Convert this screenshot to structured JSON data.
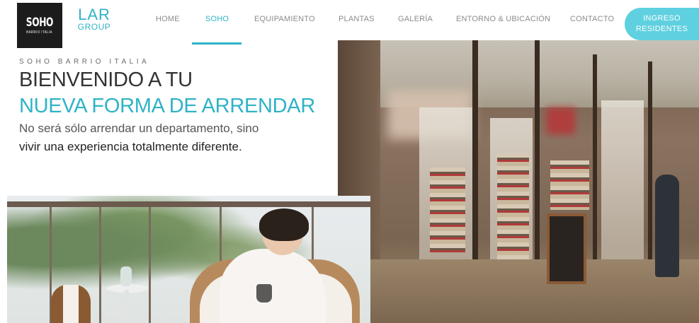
{
  "header": {
    "soho_logo": {
      "big": "SOHO",
      "small": "BARRIO ITALIA"
    },
    "lar_logo": {
      "lar": "LAR",
      "group": "GROUP"
    },
    "nav": [
      {
        "label": "HOME",
        "active": false
      },
      {
        "label": "SOHO",
        "active": true
      },
      {
        "label": "EQUIPAMIENTO",
        "active": false
      },
      {
        "label": "PLANTAS",
        "active": false
      },
      {
        "label": "GALERÍA",
        "active": false
      },
      {
        "label": "ENTORNO & UBICACIÓN",
        "active": false
      },
      {
        "label": "CONTACTO",
        "active": false
      }
    ],
    "residentes_button": {
      "line1": "INGRESO",
      "line2": "RESIDENTES"
    }
  },
  "hero": {
    "eyebrow": "SOHO BARRIO ITALIA",
    "title_line1": "BIENVENIDO A TU",
    "title_line2": "NUEVA FORMA DE ARRENDAR",
    "description_line1": "No será sólo arrendar un departamento, sino",
    "description_line2": "vivir una experiencia totalmente diferente."
  },
  "colors": {
    "accent": "#2fb3c6",
    "button": "#5fd0df",
    "logo_bg": "#1c1c1c",
    "nav_text": "#8c8c8c"
  }
}
